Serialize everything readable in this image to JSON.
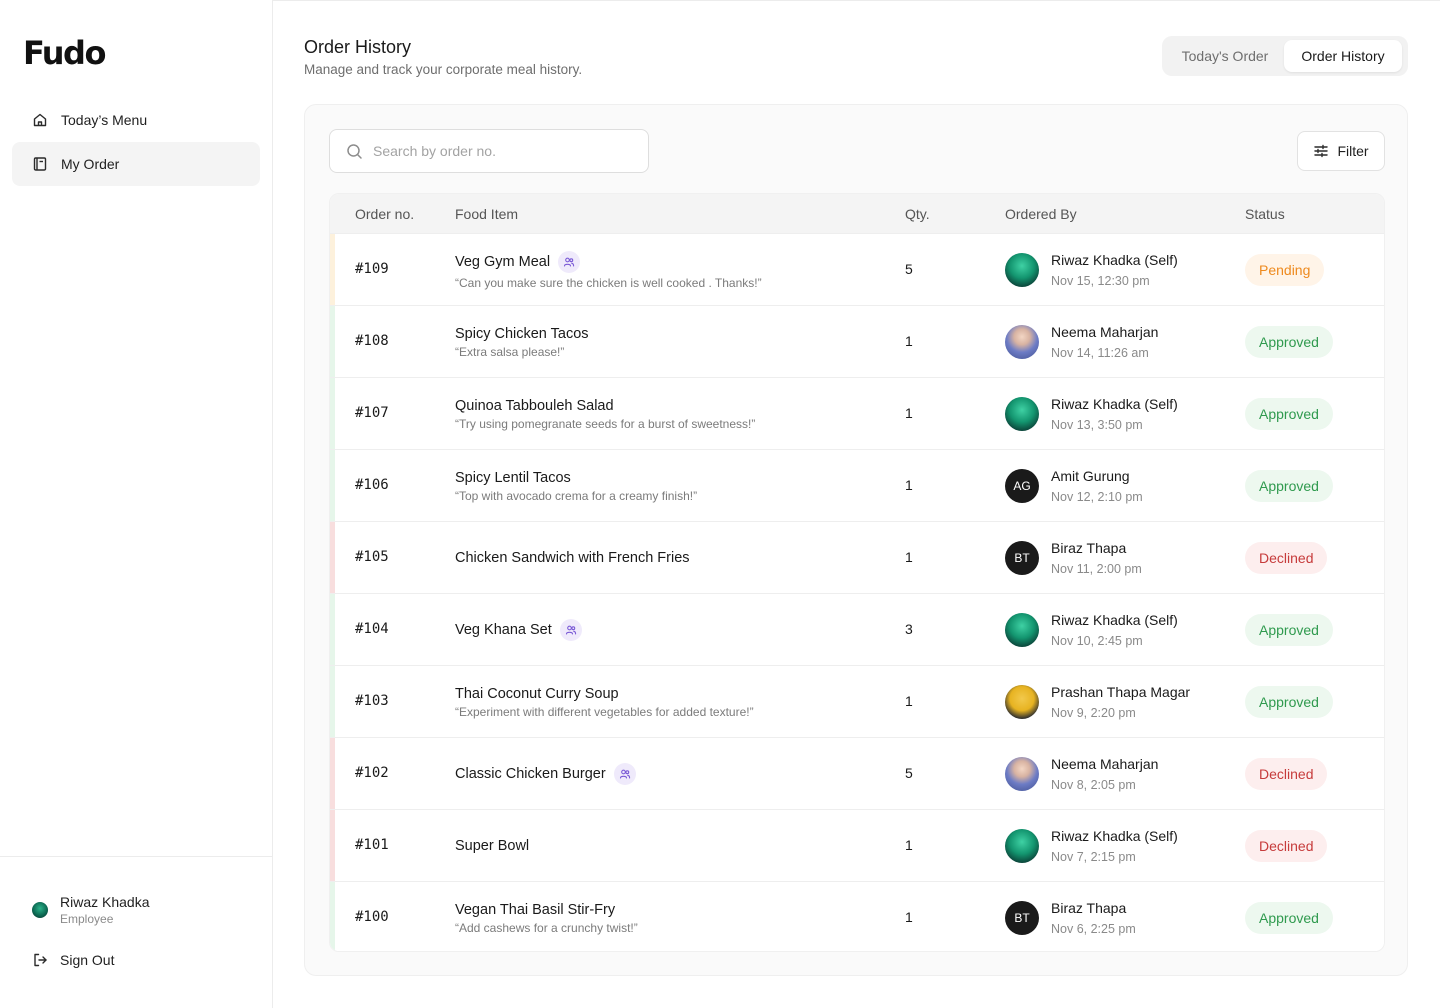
{
  "app": {
    "logo": "Fudo"
  },
  "sidebar": {
    "items": [
      {
        "label": "Today’s Menu",
        "icon": "home-icon",
        "active": false
      },
      {
        "label": "My Order",
        "icon": "book-icon",
        "active": true
      }
    ],
    "user": {
      "name": "Riwaz Khadka",
      "role": "Employee"
    },
    "signout_label": "Sign Out"
  },
  "header": {
    "title": "Order History",
    "subtitle": "Manage and track your corporate meal history.",
    "tabs": [
      {
        "label": "Today's Order",
        "active": false
      },
      {
        "label": "Order History",
        "active": true
      }
    ]
  },
  "toolbar": {
    "search_placeholder": "Search by order no.",
    "search_value": "",
    "filter_label": "Filter"
  },
  "table": {
    "columns": [
      "Order no.",
      "Food Item",
      "Qty.",
      "Ordered By",
      "Status"
    ],
    "rows": [
      {
        "no": "#109",
        "food": "Veg Gym Meal",
        "group": true,
        "note": "“Can you make sure the chicken is well cooked . Thanks!”",
        "qty": "5",
        "by": "Riwaz Khadka (Self)",
        "avatar": "riwaz",
        "initials": "",
        "time": "Nov 15, 12:30 pm",
        "status": "Pending"
      },
      {
        "no": "#108",
        "food": "Spicy Chicken Tacos",
        "group": false,
        "note": "“Extra salsa please!”",
        "qty": "1",
        "by": "Neema Maharjan",
        "avatar": "neema",
        "initials": "",
        "time": "Nov 14, 11:26 am",
        "status": "Approved"
      },
      {
        "no": "#107",
        "food": "Quinoa Tabbouleh Salad",
        "group": false,
        "note": "“Try using pomegranate seeds for a burst of sweetness!”",
        "qty": "1",
        "by": "Riwaz Khadka (Self)",
        "avatar": "riwaz",
        "initials": "",
        "time": "Nov 13, 3:50 pm",
        "status": "Approved"
      },
      {
        "no": "#106",
        "food": "Spicy Lentil Tacos",
        "group": false,
        "note": "“Top with avocado crema for a creamy finish!”",
        "qty": "1",
        "by": "Amit Gurung",
        "avatar": "initials",
        "initials": "AG",
        "time": "Nov 12, 2:10 pm",
        "status": "Approved"
      },
      {
        "no": "#105",
        "food": "Chicken Sandwich with French Fries",
        "group": false,
        "note": "",
        "qty": "1",
        "by": "Biraz Thapa",
        "avatar": "initials",
        "initials": "BT",
        "time": "Nov 11, 2:00 pm",
        "status": "Declined"
      },
      {
        "no": "#104",
        "food": "Veg Khana Set",
        "group": true,
        "note": "",
        "qty": "3",
        "by": "Riwaz Khadka (Self)",
        "avatar": "riwaz",
        "initials": "",
        "time": "Nov 10, 2:45 pm",
        "status": "Approved"
      },
      {
        "no": "#103",
        "food": "Thai Coconut Curry Soup",
        "group": false,
        "note": "“Experiment with different vegetables for added texture!”",
        "qty": "1",
        "by": "Prashan Thapa Magar",
        "avatar": "prashan",
        "initials": "",
        "time": "Nov 9, 2:20 pm",
        "status": "Approved"
      },
      {
        "no": "#102",
        "food": "Classic Chicken Burger",
        "group": true,
        "note": "",
        "qty": "5",
        "by": "Neema Maharjan",
        "avatar": "neema",
        "initials": "",
        "time": "Nov 8, 2:05 pm",
        "status": "Declined"
      },
      {
        "no": "#101",
        "food": "Super Bowl",
        "group": false,
        "note": "",
        "qty": "1",
        "by": "Riwaz Khadka (Self)",
        "avatar": "riwaz",
        "initials": "",
        "time": "Nov 7, 2:15 pm",
        "status": "Declined"
      },
      {
        "no": "#100",
        "food": "Vegan Thai Basil Stir-Fry",
        "group": false,
        "note": "“Add cashews for a crunchy twist!”",
        "qty": "1",
        "by": "Biraz Thapa",
        "avatar": "initials",
        "initials": "BT",
        "time": "Nov 6, 2:25 pm",
        "status": "Approved"
      }
    ]
  },
  "colors": {
    "pending": "#ee8a1e",
    "approved": "#2f9a4e",
    "declined": "#c63b3b",
    "stripe_pending": "#fdf1dc",
    "stripe_approved": "#e6f6ea",
    "stripe_declined": "#f8dede"
  }
}
